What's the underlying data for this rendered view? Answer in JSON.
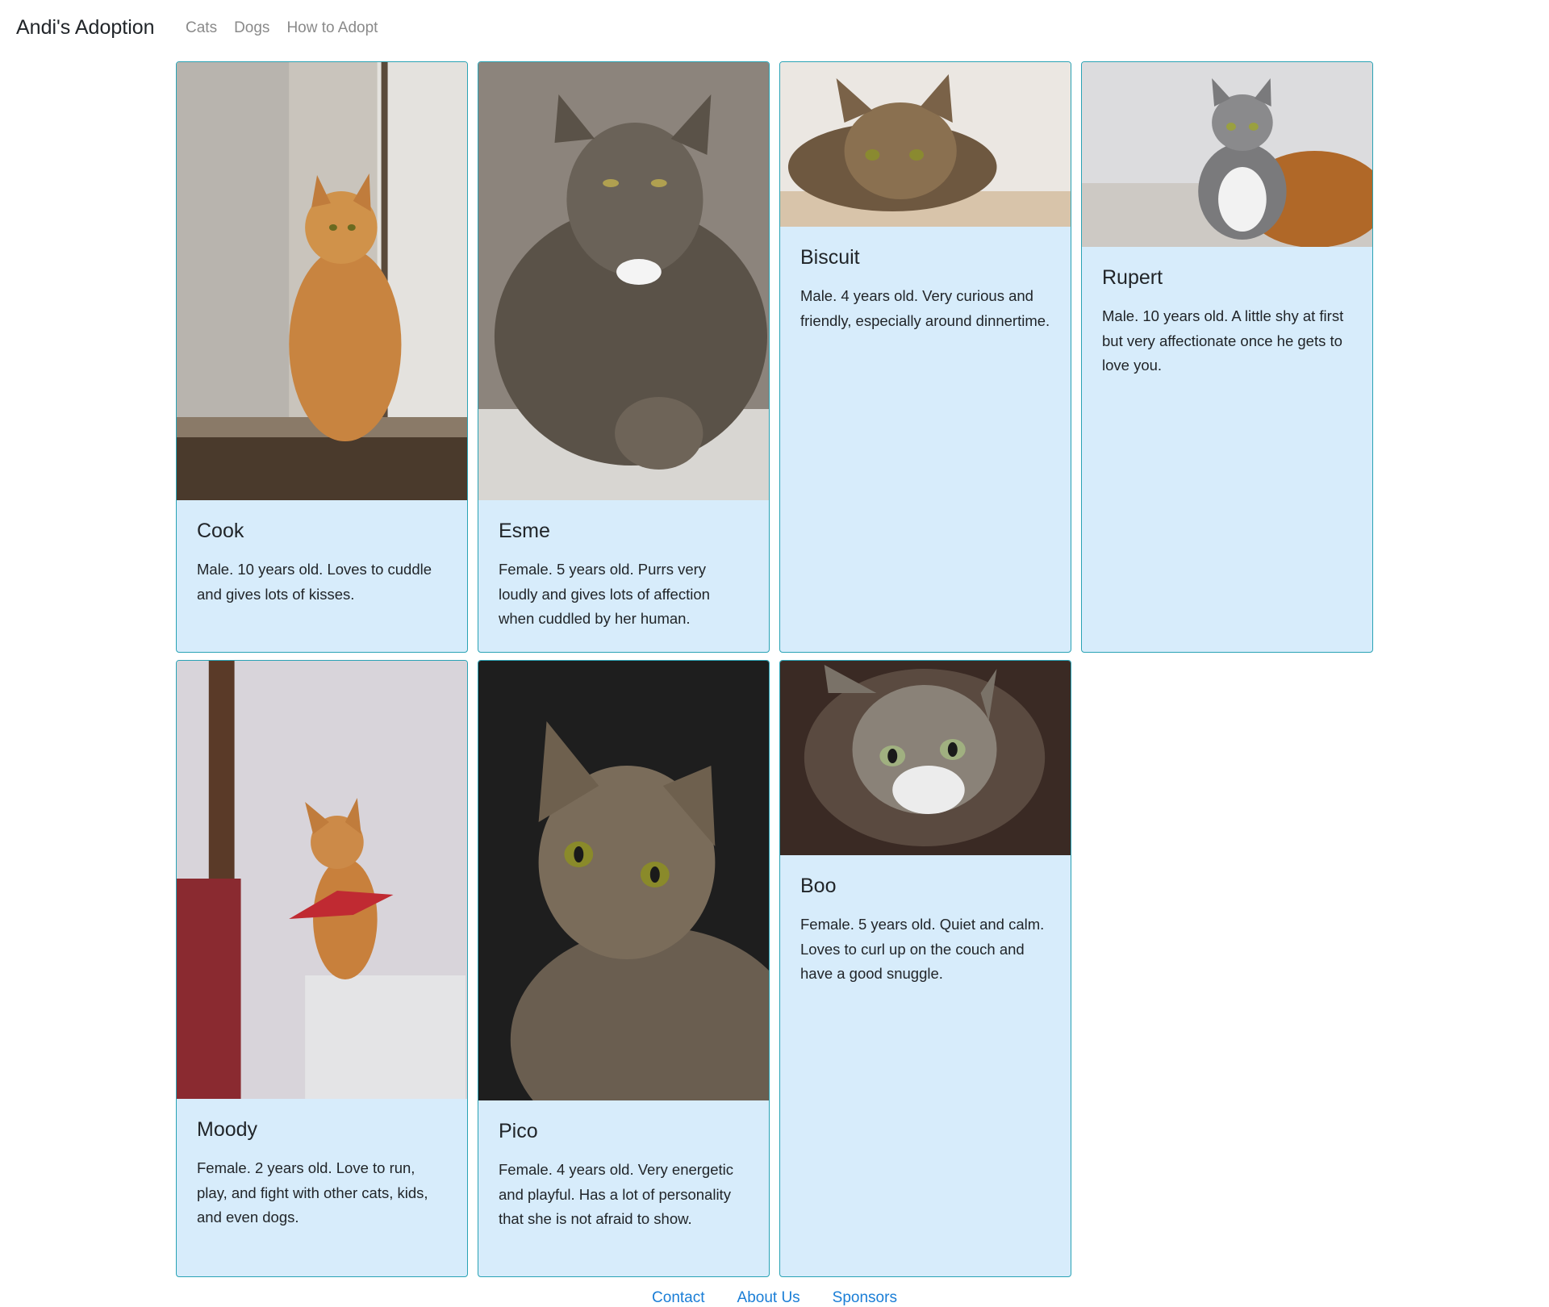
{
  "navbar": {
    "brand": "Andi's Adoption",
    "links": [
      "Cats",
      "Dogs",
      "How to Adopt"
    ]
  },
  "cards": [
    {
      "name": "Cook",
      "description": "Male. 10 years old. Loves to cuddle and gives lots of kisses."
    },
    {
      "name": "Esme",
      "description": "Female. 5 years old. Purrs very loudly and gives lots of affection when cuddled by her human."
    },
    {
      "name": "Biscuit",
      "description": "Male. 4 years old. Very curious and friendly, especially around dinnertime."
    },
    {
      "name": "Rupert",
      "description": "Male. 10 years old. A little shy at first but very affectionate once he gets to love you."
    },
    {
      "name": "Moody",
      "description": "Female. 2 years old. Love to run, play, and fight with other cats, kids, and even dogs."
    },
    {
      "name": "Pico",
      "description": "Female. 4 years old. Very energetic and playful. Has a lot of personality that she is not afraid to show."
    },
    {
      "name": "Boo",
      "description": "Female. 5 years old. Quiet and calm. Loves to curl up on the couch and have a good snuggle."
    }
  ],
  "footer": {
    "links": [
      "Contact",
      "About Us",
      "Sponsors"
    ]
  },
  "colors": {
    "card_background": "#d7ecfb",
    "card_border": "#2aa3b5",
    "footer_link": "#1a7ed6",
    "nav_link": "#8a8a8a"
  }
}
